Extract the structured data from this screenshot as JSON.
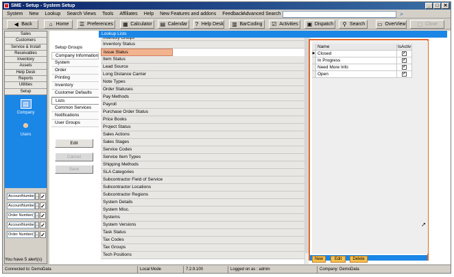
{
  "title": "SME - Setup - System Setup",
  "window_buttons": [
    "_",
    "□",
    "✕"
  ],
  "menu": [
    "System",
    "New",
    "Lookup",
    "Search Views",
    "Tools",
    "Affiliates",
    "Help",
    "New Features and addons",
    "Feedback"
  ],
  "advanced_search": {
    "label": "Advanced Search",
    "value": ""
  },
  "toolbar": [
    {
      "label": "Back",
      "icon": "back-icon"
    },
    {
      "label": "Home",
      "icon": "home-icon"
    },
    {
      "label": "Preferences",
      "icon": "preferences-icon"
    },
    {
      "label": "Calculator",
      "icon": "calculator-icon"
    },
    {
      "label": "Calendar",
      "icon": "calendar-icon"
    },
    {
      "label": "Help Desk",
      "icon": "help-icon"
    },
    {
      "label": "BarCoding",
      "icon": "barcode-icon"
    },
    {
      "label": "Activities",
      "icon": "activities-icon"
    },
    {
      "label": "Dispatch",
      "icon": "dispatch-icon"
    },
    {
      "label": "Search",
      "icon": "search-icon"
    },
    {
      "label": "OverView",
      "icon": "overview-icon"
    },
    {
      "label": "Close",
      "icon": "close-icon"
    }
  ],
  "left_nav": [
    "Sales",
    "Customers",
    "Service & Install",
    "Receivables",
    "Inventory",
    "Assets",
    "Help Desk",
    "Reports",
    "Utilities",
    "Setup"
  ],
  "nav_panel": [
    {
      "label": "Company",
      "icon": "company-icon"
    },
    {
      "label": "Users",
      "icon": "users-icon"
    }
  ],
  "account_fields": [
    {
      "label": "AccountNumbe",
      "ellipsis": "...",
      "go": "✓"
    },
    {
      "label": "AccountNumbe",
      "ellipsis": "...",
      "go": "✓"
    },
    {
      "label": "Order Number(",
      "ellipsis": "...",
      "go": "✓"
    },
    {
      "label": "AccountNumbe",
      "ellipsis": "...",
      "go": "✓"
    },
    {
      "label": "Order Number(",
      "ellipsis": "...",
      "go": "✓"
    }
  ],
  "alerts_text": "You have 5 alert(s)",
  "lookup_header": "Lookup Lists",
  "setup_tabs": [
    "Setup Groups",
    "Company Information",
    "System",
    "Order",
    "Printing",
    "Inventory",
    "Customer Defaults",
    "Lists",
    "Common Services",
    "Notifications",
    "User Groups"
  ],
  "actions": {
    "edit": "Edit",
    "cancel": "Cancel",
    "save": "Save"
  },
  "lookup_lists": [
    "Inventory Groups",
    "Inventory Status",
    "Issue Status",
    "Item Status",
    "Lead Source",
    "Long Distance Carrier",
    "Note Types",
    "Order Statuses",
    "Pay Methods",
    "Payroll",
    "Purchase Order Status",
    "Price Books",
    "Project Status",
    "Sales Actions",
    "Sales Stages",
    "Service Codes",
    "Service Item Types",
    "Shipping Methods",
    "SLA Categories",
    "Subcontractor Field of Service",
    "Subcontractor Locations",
    "Subcontractor Regions",
    "System Details",
    "System Misc.",
    "Systems",
    "System Versions",
    "Task Status",
    "Tax Codes",
    "Tax Groups",
    "Tech Positions"
  ],
  "selected_lookup": "Issue Status",
  "grid": {
    "columns": [
      "Name",
      "IsActiv"
    ],
    "rows": [
      {
        "indicator": "▶",
        "name": "Closed",
        "active": "✓"
      },
      {
        "indicator": "",
        "name": "In Progress",
        "active": "✓"
      },
      {
        "indicator": "",
        "name": "Need More Info",
        "active": "✓"
      },
      {
        "indicator": "",
        "name": "Open",
        "active": "✓"
      }
    ]
  },
  "grid_buttons": [
    "New",
    "Edit",
    "Delete"
  ],
  "status": {
    "connection": "Connected to: DemoData",
    "mode": "Local Mode",
    "version": "7.2.9.100",
    "logged_on": "Logged on as : admin",
    "company": "Company: DemoData"
  }
}
